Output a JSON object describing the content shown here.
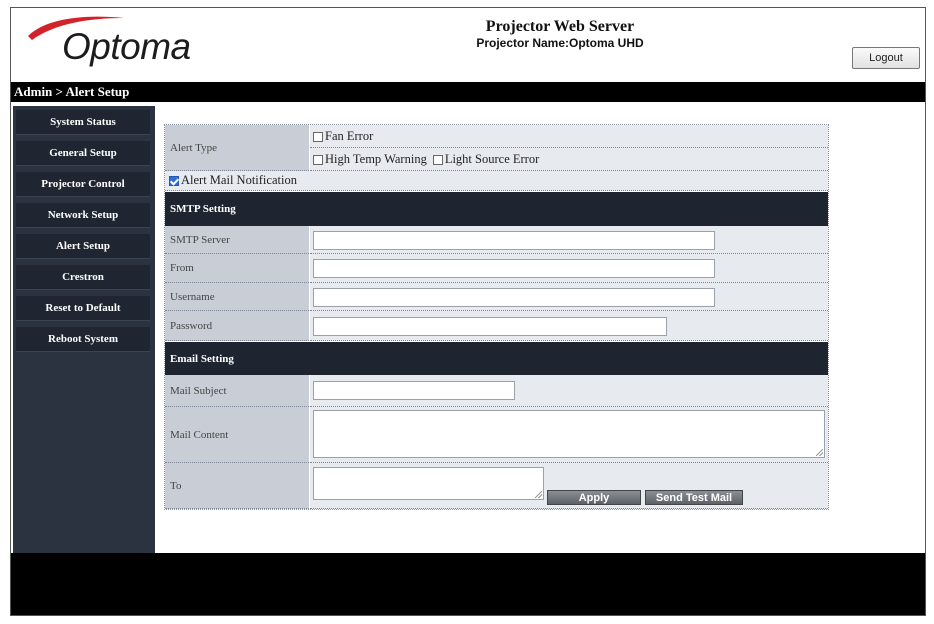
{
  "header": {
    "logo_text": "Optoma",
    "title": "Projector Web Server",
    "projector_name": "Projector Name:Optoma UHD",
    "logout_label": "Logout"
  },
  "breadcrumb": "Admin > Alert Setup",
  "sidebar": {
    "items": [
      {
        "label": "System Status"
      },
      {
        "label": "General Setup"
      },
      {
        "label": "Projector Control"
      },
      {
        "label": "Network Setup"
      },
      {
        "label": "Alert Setup"
      },
      {
        "label": "Crestron"
      },
      {
        "label": "Reset to Default"
      },
      {
        "label": "Reboot System"
      }
    ]
  },
  "form": {
    "alert_type_label": "Alert Type",
    "fan_error": {
      "label": "Fan Error",
      "checked": false
    },
    "high_temp": {
      "label": "High Temp Warning",
      "checked": false
    },
    "light_source": {
      "label": "Light Source Error",
      "checked": false
    },
    "alert_mail": {
      "label": "Alert Mail Notification",
      "checked": true
    },
    "smtp_section": "SMTP Setting",
    "smtp_server_label": "SMTP Server",
    "from_label": "From",
    "username_label": "Username",
    "password_label": "Password",
    "email_section": "Email Setting",
    "mail_subject_label": "Mail Subject",
    "mail_content_label": "Mail Content",
    "to_label": "To",
    "apply_label": "Apply",
    "send_test_label": "Send Test Mail"
  },
  "colors": {
    "sidebar_bg": "#2b3340",
    "nav_item_bg": "#1f2632",
    "section_bar": "#1e2530",
    "label_cell": "#c9ced6",
    "value_cell": "#e7eaef",
    "logo_swoosh": "#d2232a"
  }
}
